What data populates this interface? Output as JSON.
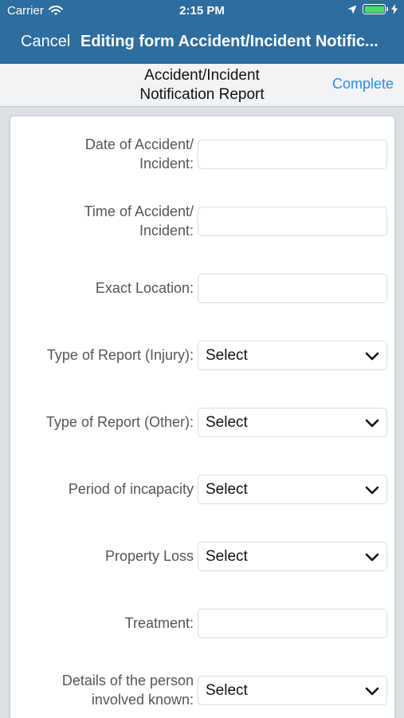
{
  "status_bar": {
    "carrier": "Carrier",
    "time": "2:15 PM"
  },
  "nav": {
    "cancel_label": "Cancel",
    "title": "Editing form Accident/Incident Notific..."
  },
  "subheader": {
    "title_line1": "Accident/Incident",
    "title_line2": "Notification Report",
    "complete_label": "Complete"
  },
  "colors": {
    "nav_bar": "#2d6d9f",
    "accent_link": "#2b8be8",
    "battery": "#4cd964"
  },
  "form": {
    "date": {
      "label_line1": "Date of Accident/",
      "label_line2": "Incident:",
      "value": ""
    },
    "time": {
      "label_line1": "Time of Accident/",
      "label_line2": "Incident:",
      "value": ""
    },
    "location": {
      "label": "Exact Location:",
      "value": ""
    },
    "report_injury": {
      "label": "Type of Report (Injury):",
      "value": "Select"
    },
    "report_other": {
      "label": "Type of Report (Other):",
      "value": "Select"
    },
    "incapacity": {
      "label": "Period of incapacity",
      "value": "Select"
    },
    "property_loss": {
      "label": "Property Loss",
      "value": "Select"
    },
    "treatment": {
      "label": "Treatment:",
      "value": ""
    },
    "person_details": {
      "label_line1": "Details of the person",
      "label_line2": "involved known:",
      "value": "Select"
    }
  }
}
